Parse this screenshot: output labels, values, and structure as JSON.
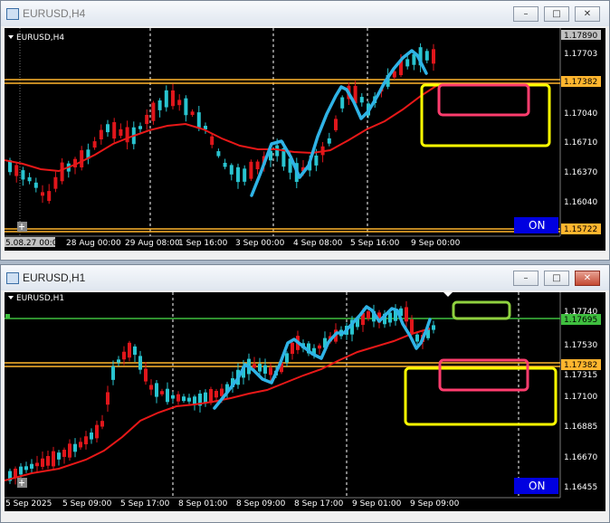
{
  "windows": [
    {
      "title": "EURUSD,H4",
      "symbol_label": "EURUSD,H4",
      "price_axis": [
        "1.17890",
        "1.17703",
        "1.17382",
        "1.17040",
        "1.16710",
        "1.16370",
        "1.16040",
        "1.15722"
      ],
      "highlighted_prices": {
        "top": "1.17890",
        "current": "1.17703",
        "level": "1.17382",
        "bottom": "1.15722"
      },
      "time_axis": [
        "5.08.27 00:00",
        "28 Aug 00:00",
        "29 Aug 08:00",
        "1 Sep 16:00",
        "3 Sep 00:00",
        "4 Sep 08:00",
        "5 Sep 16:00",
        "9 Sep 00:00"
      ],
      "on_button": "ON",
      "buttons": {
        "minimize": "–",
        "maximize": "□",
        "close": "✕"
      }
    },
    {
      "title": "EURUSD,H1",
      "symbol_label": "EURUSD,H1",
      "price_axis": [
        "1.17740",
        "1.17695",
        "1.17530",
        "1.17382",
        "1.17315",
        "1.17100",
        "1.16885",
        "1.16670",
        "1.16455"
      ],
      "highlighted_prices": {
        "current": "1.17695",
        "level": "1.17382"
      },
      "time_axis": [
        "5 Sep 2025",
        "5 Sep 09:00",
        "5 Sep 17:00",
        "8 Sep 01:00",
        "8 Sep 09:00",
        "8 Sep 17:00",
        "9 Sep 01:00",
        "9 Sep 09:00"
      ],
      "on_button": "ON",
      "buttons": {
        "minimize": "–",
        "maximize": "□",
        "close": "✕"
      }
    }
  ],
  "colors": {
    "chart_bg": "#000000",
    "bull_candle": "#29c4d0",
    "bear_candle": "#e0161b",
    "moving_average": "#e81818",
    "drawn_trend": "#2fb3e6",
    "level_line": "#ffb52e",
    "current_line": "#3fbf3f",
    "box_yellow": "#ffff00",
    "box_pink": "#ff3d6e",
    "box_green": "#8fd13f",
    "on_button_bg": "#0000e0"
  }
}
